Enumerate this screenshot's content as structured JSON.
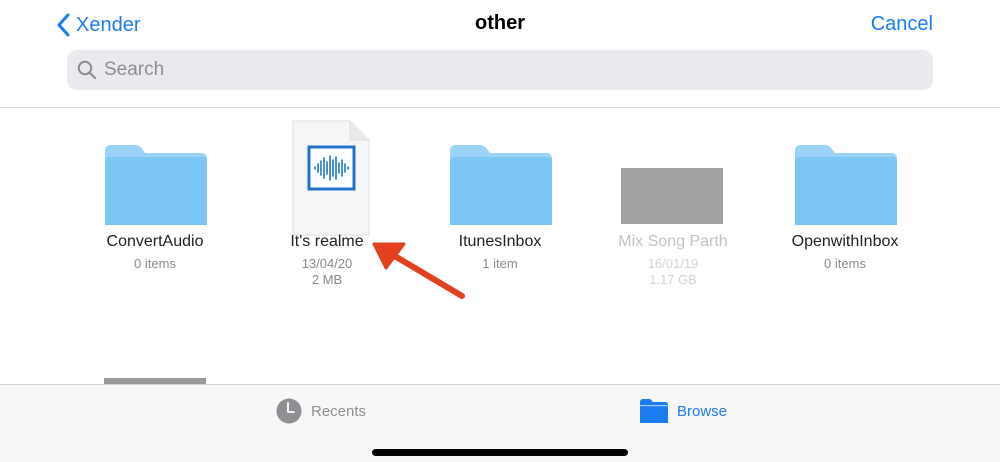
{
  "colors": {
    "accent": "#1b7cf2",
    "folder": "#7cc6f4",
    "search_bg": "#e9e9ee",
    "arrow": "#e2401f"
  },
  "nav": {
    "back_label": "Xender",
    "title": "other",
    "cancel_label": "Cancel"
  },
  "search": {
    "placeholder": "Search",
    "value": ""
  },
  "items": [
    {
      "name": "ConvertAudio",
      "kind": "folder",
      "meta1": "0 items",
      "meta2": "",
      "dimmed": false
    },
    {
      "name": "It's realme",
      "kind": "audio-file",
      "meta1": "13/04/20",
      "meta2": "2 MB",
      "dimmed": false
    },
    {
      "name": "ItunesInbox",
      "kind": "folder",
      "meta1": "1 item",
      "meta2": "",
      "dimmed": false
    },
    {
      "name": "Mix Song Parth",
      "kind": "file",
      "meta1": "16/01/19",
      "meta2": "1.17 GB",
      "dimmed": true
    },
    {
      "name": "OpenwithInbox",
      "kind": "folder",
      "meta1": "0 items",
      "meta2": "",
      "dimmed": false
    }
  ],
  "tabbar": {
    "recents_label": "Recents",
    "browse_label": "Browse",
    "selected": "Browse"
  }
}
